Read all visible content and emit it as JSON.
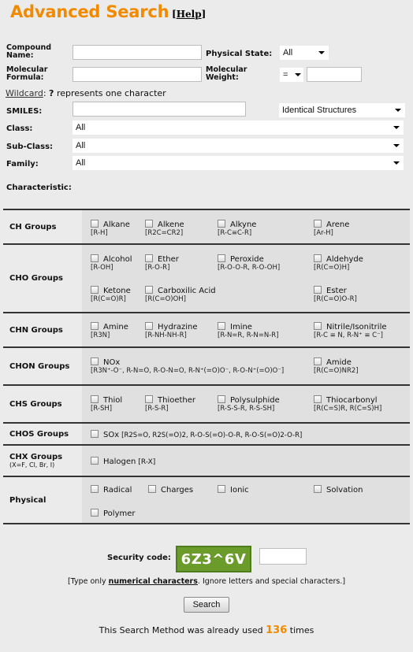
{
  "header": {
    "title": "Advanced Search",
    "help": "Help",
    "bracket_l": "[",
    "bracket_r": "]"
  },
  "form": {
    "compound_name_label": "Compound Name:",
    "physical_state_label": "Physical State:",
    "physical_state_value": "All",
    "molecular_formula_label": "Molecular Formula:",
    "molecular_weight_label": "Molecular Weight:",
    "mw_operator": "=",
    "wildcard_link": "Wildcard",
    "wildcard_q": "?",
    "wildcard_text": "represents one character",
    "smiles_label": "SMILES:",
    "smiles_mode": "Identical Structures",
    "class_label": "Class:",
    "class_value": "All",
    "subclass_label": "Sub-Class:",
    "subclass_value": "All",
    "family_label": "Family:",
    "family_value": "All",
    "characteristic_label": "Characteristic:"
  },
  "groups": [
    {
      "name": "CH Groups",
      "items": [
        {
          "label": "Alkane",
          "formula": "[R-H]"
        },
        {
          "label": "Alkene",
          "formula": "[R2C=CR2]"
        },
        {
          "label": "Alkyne",
          "formula": "[R-C≡C-R]"
        },
        {
          "label": "Arene",
          "formula": "[Ar-H]"
        }
      ]
    },
    {
      "name": "CHO Groups",
      "items": [
        {
          "label": "Alcohol",
          "formula": "[R-OH]"
        },
        {
          "label": "Ether",
          "formula": "[R-O-R]"
        },
        {
          "label": "Peroxide",
          "formula": "[R-O-O-R, R-O-OH]"
        },
        {
          "label": "Aldehyde",
          "formula": "[R(C=O)H]"
        },
        {
          "label": "Ketone",
          "formula": "[R(C=O)R]"
        },
        {
          "label": "Carboxilic Acid",
          "formula": "[R(C=O)OH]"
        },
        {
          "label": "Ester",
          "formula": "[R(C=O)O-R]"
        }
      ]
    },
    {
      "name": "CHN Groups",
      "items": [
        {
          "label": "Amine",
          "formula": "[R3N]"
        },
        {
          "label": "Hydrazine",
          "formula": "[R-NH-NH-R]"
        },
        {
          "label": "Imine",
          "formula": "[R-N=R, R-N=N-R]"
        },
        {
          "label": "Nitrile/Isonitrile",
          "formula": "[R-C ≡ N, R-N⁺ ≡ C⁻]"
        }
      ]
    },
    {
      "name": "CHON Groups",
      "items": [
        {
          "label": "NOx",
          "formula": "[R3N⁺-O⁻, R-N=O, R-O-N=O, R-N⁺(=O)O⁻, R-O-N⁺(=O)O⁻]"
        },
        {
          "label": "Amide",
          "formula": "[R(C=O)NR2]"
        }
      ]
    },
    {
      "name": "CHS Groups",
      "items": [
        {
          "label": "Thiol",
          "formula": "[R-SH]"
        },
        {
          "label": "Thioether",
          "formula": "[R-S-R]"
        },
        {
          "label": "Polysulphide",
          "formula": "[R-S-S-R, R-S-SH]"
        },
        {
          "label": "Thiocarbonyl",
          "formula": "[R(C=S)R, R(C=S)H]"
        }
      ]
    },
    {
      "name": "CHOS Groups",
      "items": [
        {
          "label": "SOx",
          "formula": "[R2S=O, R2S(=O)2, R-O-S(=O)-O-R, R-O-S(=O)2-O-R]"
        }
      ]
    },
    {
      "name": "CHX Groups",
      "sub": "(X=F, Cl, Br, I)",
      "items": [
        {
          "label": "Halogen",
          "formula": "[R-X]"
        }
      ]
    },
    {
      "name": "Physical",
      "items": [
        {
          "label": "Radical"
        },
        {
          "label": "Charges"
        },
        {
          "label": "Ionic"
        },
        {
          "label": "Solvation"
        },
        {
          "label": "Polymer"
        }
      ]
    }
  ],
  "security": {
    "label": "Security code:",
    "code": "6Z3^6V",
    "hint_pre": "[Type only",
    "hint_strong": "numerical characters",
    "hint_post": ". Ignore letters and special characters.]",
    "button": "Search"
  },
  "footer": {
    "pre": "This Search Method was already used",
    "count": "136",
    "post": "times"
  }
}
